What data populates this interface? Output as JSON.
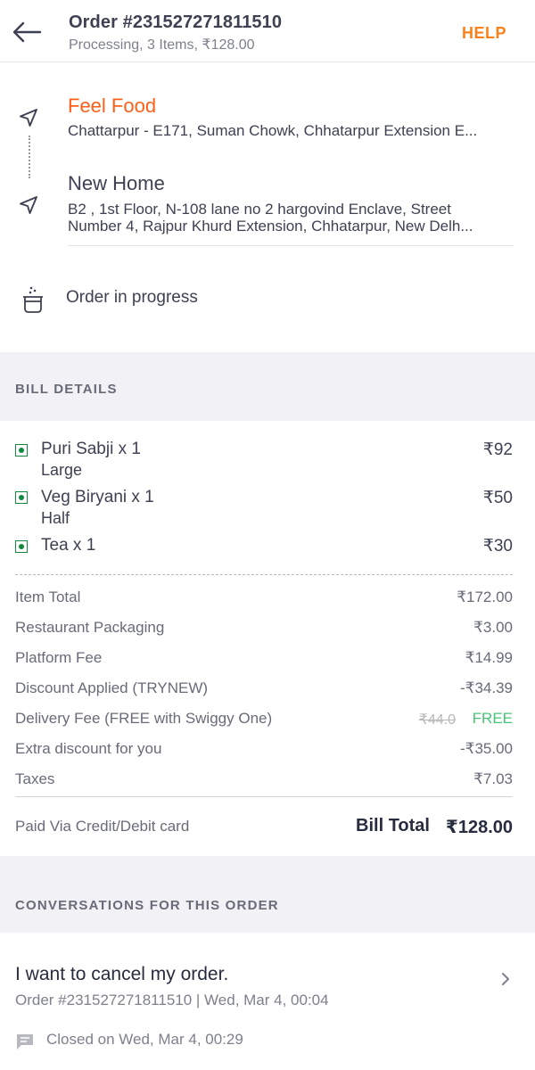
{
  "header": {
    "order_title": "Order #231527271811510",
    "order_subtitle": "Processing, 3 Items, ₹128.00",
    "help_label": "HELP"
  },
  "pickup": {
    "name": "Feel Food",
    "address": "Chattarpur - E171, Suman Chowk, Chhatarpur Extension E..."
  },
  "drop": {
    "name": "New Home",
    "address_line1": "B2 , 1st Floor, N-108 lane no 2 hargovind Enclave, Street",
    "address_line2": "Number 4, Rajpur Khurd Extension, Chhatarpur, New Delh..."
  },
  "status": {
    "label": "Order in progress"
  },
  "bill": {
    "section_title": "BILL DETAILS",
    "items": [
      {
        "name": "Puri Sabji x 1",
        "variant": "Large",
        "price": "₹92"
      },
      {
        "name": "Veg Biryani x 1",
        "variant": "Half",
        "price": "₹50"
      },
      {
        "name": "Tea x 1",
        "variant": "",
        "price": "₹30"
      }
    ],
    "charges": [
      {
        "label": "Item Total",
        "value": "₹172.00"
      },
      {
        "label": "Restaurant Packaging",
        "value": "₹3.00"
      },
      {
        "label": "Platform Fee",
        "value": "₹14.99"
      },
      {
        "label": "Discount Applied (TRYNEW)",
        "value": "-₹34.39"
      },
      {
        "label": "Delivery Fee (FREE with Swiggy One)",
        "original": "₹44.0",
        "value": "FREE"
      },
      {
        "label": "Extra discount for you",
        "value": "-₹35.00"
      },
      {
        "label": "Taxes",
        "value": "₹7.03"
      }
    ],
    "paid_via": "Paid Via Credit/Debit card",
    "total_label": "Bill Total",
    "total_value": "₹128.00"
  },
  "conversations": {
    "section_title": "CONVERSATIONS FOR THIS ORDER",
    "items": [
      {
        "title": "I want to cancel my order.",
        "meta": "Order #231527271811510 | Wed, Mar 4, 00:04",
        "status": "Closed on Wed, Mar 4, 00:29"
      }
    ]
  },
  "icons": {
    "back": "arrow-left-icon",
    "pickup": "navigation-arrow-icon",
    "drop": "navigation-arrow-icon",
    "progress": "cooking-pot-icon",
    "veg": "veg-mark-icon",
    "chevron": "chevron-right-icon",
    "chat": "chat-bubble-icon"
  },
  "colors": {
    "accent": "#fc8019",
    "restaurant_name": "#fc5f1a",
    "veg": "#0f8a3e",
    "free": "#48c479",
    "section_bg": "#f1f1f6"
  }
}
